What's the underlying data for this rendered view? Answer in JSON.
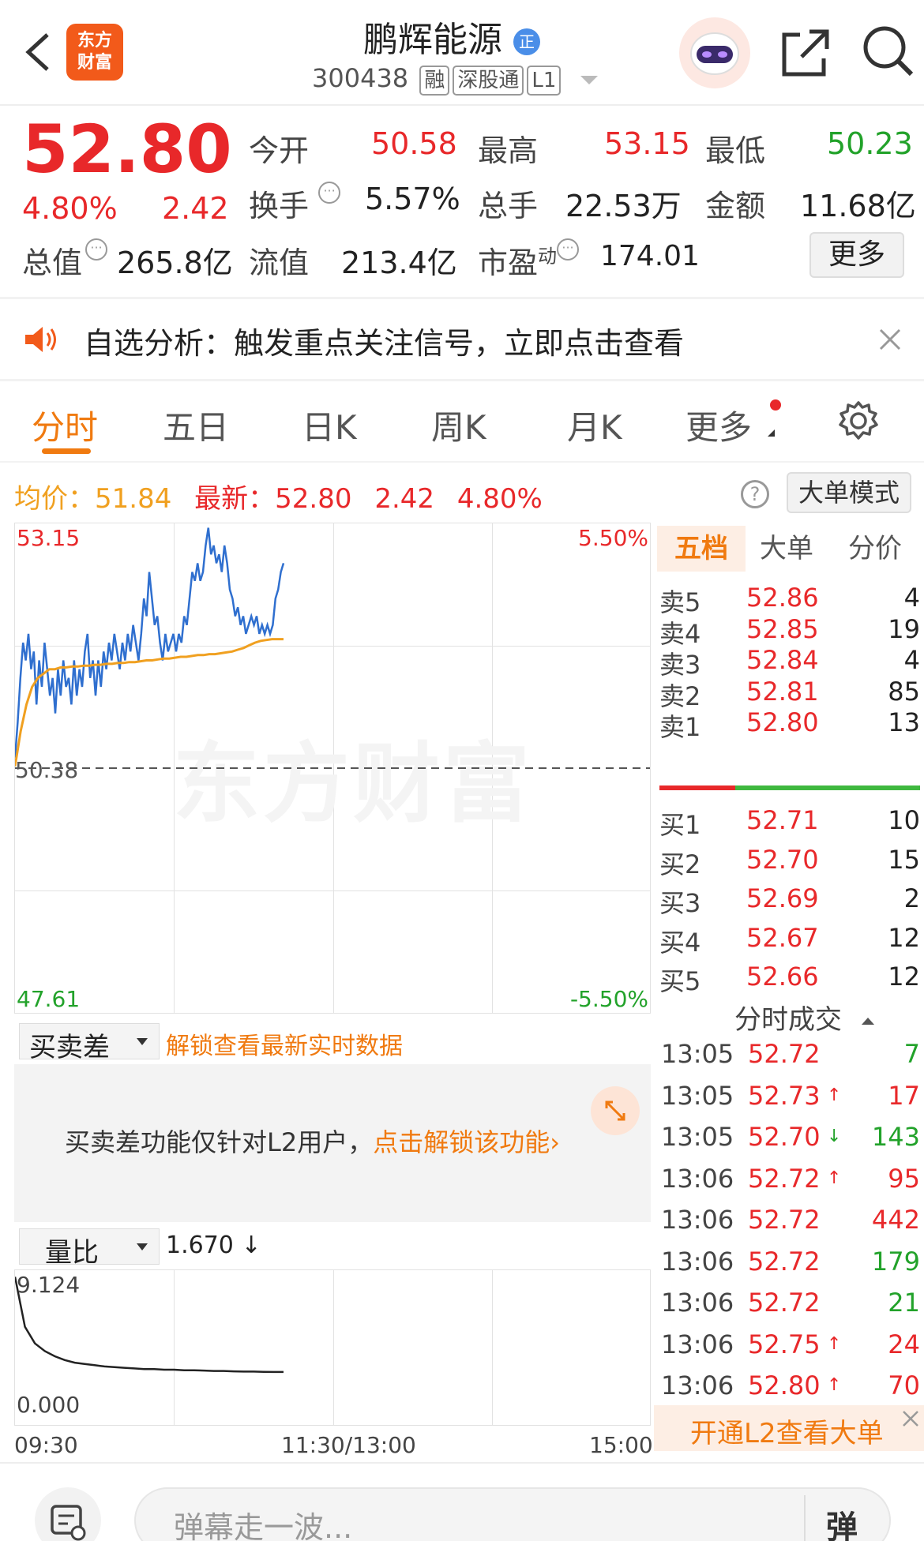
{
  "header": {
    "stock_name": "鹏辉能源",
    "badge": "正",
    "code": "300438",
    "tags": [
      "融",
      "深股通",
      "L1"
    ],
    "logo_line1": "东方",
    "logo_line2": "财富"
  },
  "quote": {
    "price": "52.80",
    "change_pct": "4.80%",
    "change": "2.42",
    "open_label": "今开",
    "open": "50.58",
    "high_label": "最高",
    "high": "53.15",
    "low_label": "最低",
    "low": "50.23",
    "turnover_label": "换手",
    "turnover": "5.57%",
    "volume_label": "总手",
    "volume": "22.53万",
    "amount_label": "金额",
    "amount": "11.68亿",
    "mktcap_label": "总值",
    "mktcap": "265.8亿",
    "float_label": "流值",
    "float_cap": "213.4亿",
    "pe_label": "市盈",
    "pe_sup": "动",
    "pe": "174.01",
    "more_button": "更多"
  },
  "notice": {
    "text": "自选分析：触发重点关注信号，立即点击查看"
  },
  "tabs": [
    "分时",
    "五日",
    "日K",
    "周K",
    "月K",
    "更多"
  ],
  "chart_info": {
    "avg_label": "均价：",
    "avg": "51.84",
    "latest_label": "最新：",
    "latest": "52.80",
    "latest_change": "2.42",
    "latest_pct": "4.80%",
    "mode_button": "大单模式"
  },
  "chart_data": [
    {
      "type": "line",
      "y_left_top": "53.15",
      "y_left_mid": "50.38",
      "y_left_bottom": "47.61",
      "y_right_top": "5.50%",
      "y_right_bottom": "-5.50%",
      "ylim": [
        47.61,
        53.15
      ],
      "prev_close": 50.38,
      "x_labels": [
        "09:30",
        "11:30/13:00",
        "15:00"
      ],
      "watermark": "东方财富",
      "series": [
        {
          "name": "",
          "color": "#2f6fcf",
          "values": [
            50.5,
            50.9,
            51.4,
            51.8,
            51.6,
            51.9,
            51.5,
            51.7,
            51.1,
            51.6,
            51.3,
            51.8,
            51.5,
            51.2,
            51.4,
            51.0,
            51.5,
            51.2,
            51.6,
            51.3,
            51.4,
            51.1,
            51.6,
            51.2,
            51.5,
            51.3,
            51.7,
            51.9,
            51.4,
            51.6,
            51.2,
            51.6,
            51.3,
            51.7,
            51.5,
            51.8,
            51.6,
            51.9,
            51.7,
            51.5,
            51.8,
            51.6,
            51.9,
            51.7,
            52.0,
            51.8,
            51.6,
            51.9,
            52.3,
            52.1,
            52.6,
            52.3,
            52.0,
            52.1,
            51.8,
            51.6,
            51.9,
            51.7,
            51.8,
            51.9,
            51.7,
            51.9,
            51.8,
            52.1,
            52.0,
            52.3,
            52.6,
            52.5,
            52.7,
            52.5,
            52.6,
            52.9,
            53.1,
            52.8,
            52.9,
            52.7,
            52.8,
            52.6,
            52.9,
            52.7,
            52.4,
            52.3,
            52.1,
            52.2,
            52.0,
            52.1,
            51.9,
            52.0,
            52.1,
            52.0,
            52.1,
            51.9,
            52.0,
            51.9,
            52.0,
            51.9,
            52.0,
            52.3,
            52.4,
            52.6,
            52.7
          ],
          "note": ""
        },
        {
          "name": "",
          "color": "#f0a020",
          "values": [
            50.4,
            50.8,
            51.1,
            51.3,
            51.4,
            51.45,
            51.5,
            51.5,
            51.52,
            51.52,
            51.53,
            51.53,
            51.54,
            51.54,
            51.55,
            51.55,
            51.56,
            51.56,
            51.57,
            51.57,
            51.58,
            51.58,
            51.59,
            51.6,
            51.6,
            51.61,
            51.62,
            51.62,
            51.63,
            51.64,
            51.64,
            51.65,
            51.66,
            51.66,
            51.67,
            51.67,
            51.68,
            51.69,
            51.7,
            51.72,
            51.74,
            51.77,
            51.8,
            51.82,
            51.83,
            51.84,
            51.84,
            51.84
          ]
        }
      ]
    },
    {
      "type": "line",
      "label": "量比",
      "value_text": "1.670",
      "ymax_label": "9.124",
      "ymin_label": "0.000",
      "ylim": [
        0,
        9.124
      ],
      "series": [
        {
          "name": "",
          "color": "#222",
          "values": [
            9.1,
            5.2,
            3.9,
            3.3,
            2.9,
            2.6,
            2.4,
            2.3,
            2.2,
            2.1,
            2.05,
            2.0,
            1.95,
            1.9,
            1.9,
            1.85,
            1.85,
            1.8,
            1.8,
            1.78,
            1.75,
            1.75,
            1.72,
            1.7,
            1.7,
            1.68,
            1.67,
            1.67
          ]
        }
      ]
    }
  ],
  "orderbook": {
    "tabs": [
      "五档",
      "大单",
      "分价"
    ],
    "sells": [
      {
        "label": "卖5",
        "price": "52.86",
        "vol": "4"
      },
      {
        "label": "卖4",
        "price": "52.85",
        "vol": "19"
      },
      {
        "label": "卖3",
        "price": "52.84",
        "vol": "4"
      },
      {
        "label": "卖2",
        "price": "52.81",
        "vol": "85"
      },
      {
        "label": "卖1",
        "price": "52.80",
        "vol": "13"
      }
    ],
    "buys": [
      {
        "label": "买1",
        "price": "52.71",
        "vol": "10"
      },
      {
        "label": "买2",
        "price": "52.70",
        "vol": "15"
      },
      {
        "label": "买3",
        "price": "52.69",
        "vol": "2"
      },
      {
        "label": "买4",
        "price": "52.67",
        "vol": "12"
      },
      {
        "label": "买5",
        "price": "52.66",
        "vol": "12"
      }
    ]
  },
  "trades": {
    "title": "分时成交",
    "rows": [
      {
        "time": "13:05",
        "price": "52.72",
        "arrow": "",
        "vol": "7",
        "color": "#22a22a"
      },
      {
        "time": "13:05",
        "price": "52.73",
        "arrow": "↑",
        "vol": "17",
        "color": "#e8282a"
      },
      {
        "time": "13:05",
        "price": "52.70",
        "arrow": "↓",
        "vol": "143",
        "color": "#22a22a"
      },
      {
        "time": "13:06",
        "price": "52.72",
        "arrow": "↑",
        "vol": "95",
        "color": "#e8282a"
      },
      {
        "time": "13:06",
        "price": "52.72",
        "arrow": "",
        "vol": "442",
        "color": "#e8282a"
      },
      {
        "time": "13:06",
        "price": "52.72",
        "arrow": "",
        "vol": "179",
        "color": "#22a22a"
      },
      {
        "time": "13:06",
        "price": "52.72",
        "arrow": "",
        "vol": "21",
        "color": "#22a22a"
      },
      {
        "time": "13:06",
        "price": "52.75",
        "arrow": "↑",
        "vol": "24",
        "color": "#e8282a"
      },
      {
        "time": "13:06",
        "price": "52.80",
        "arrow": "↑",
        "vol": "70",
        "color": "#e8282a"
      }
    ],
    "l2_banner": "开通L2查看大单"
  },
  "spread": {
    "select": "买卖差",
    "unlock_link": "解锁查看最新实时数据",
    "info_text": "买卖差功能仅针对L2用户，",
    "info_link": "点击解锁该功能›"
  },
  "bottom": {
    "danmu_placeholder": "弹幕走一波...",
    "danmu_button": "弹"
  }
}
